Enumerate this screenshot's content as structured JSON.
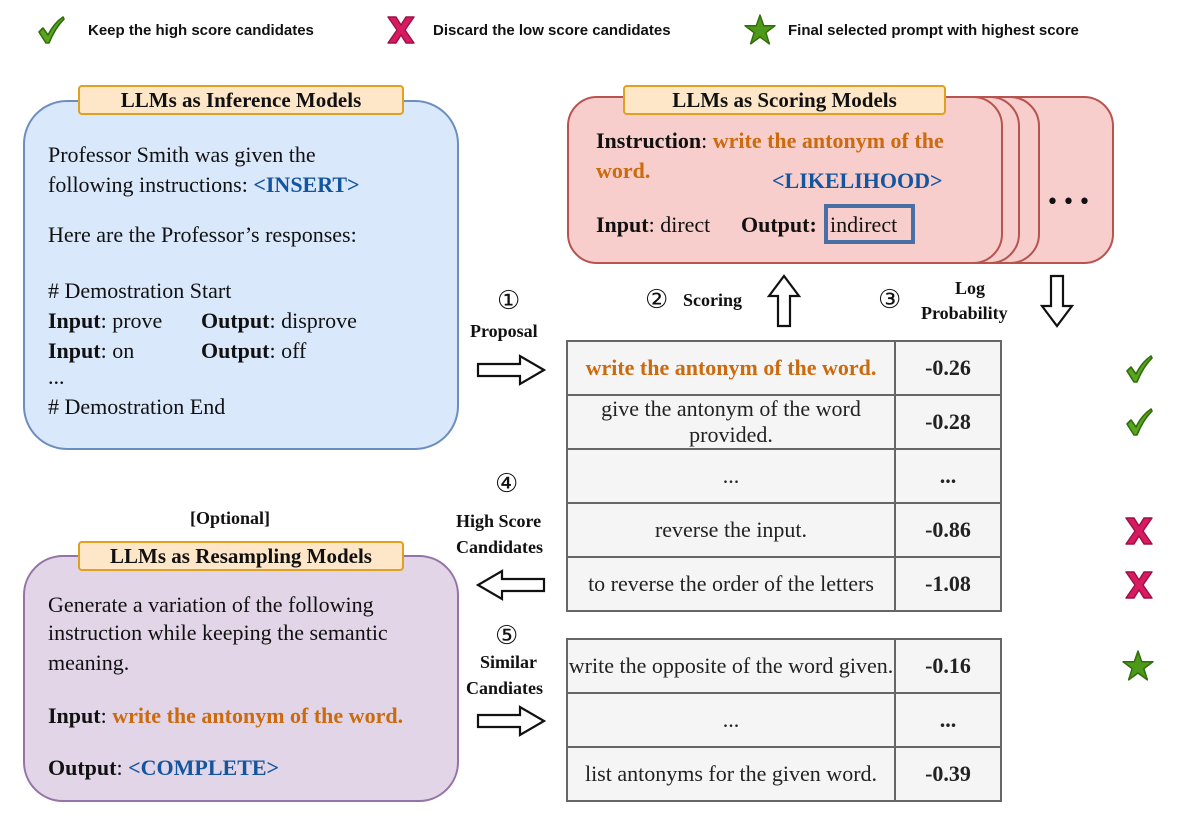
{
  "legend": [
    {
      "icon": "check-icon",
      "label": "Keep the high score candidates"
    },
    {
      "icon": "x-icon",
      "label": "Discard the low score candidates"
    },
    {
      "icon": "star-icon",
      "label": "Final selected prompt with highest score"
    }
  ],
  "colors": {
    "check_green": "#4d9a1a",
    "x_magenta": "#c2185b",
    "star_green": "#4d9a1a",
    "inference_fill": "#dae8fc",
    "scoring_fill": "#f8cecc",
    "resampling_fill": "#e1d5e7",
    "tag_fill": "#fde7c8",
    "keyword_blue": "#1455a0",
    "keyword_orange": "#cc6a0e",
    "score_good": "#1a9a1a",
    "score_bad": "#990000"
  },
  "inference": {
    "title": "LLMs as Inference Models",
    "line1": "Professor Smith was given the",
    "line2_prefix": "following instructions: ",
    "line2_keyword": "<INSERT>",
    "line3": "Here are the Professor’s responses:",
    "demo_start": "# Demostration Start",
    "examples": [
      {
        "input_label": "Input",
        "input": ": prove",
        "output_label": "Output",
        "output": ": disprove"
      },
      {
        "input_label": "Input",
        "input": ": on",
        "output_label": "Output",
        "output": ": off"
      }
    ],
    "ellipsis": "...",
    "demo_end": "# Demostration End"
  },
  "scoring": {
    "title": "LLMs as Scoring Models",
    "instruction_label": "Instruction",
    "instruction_sep": ": ",
    "instruction_line1": "write the antonym of the",
    "instruction_line2": "word.",
    "likelihood": "<LIKELIHOOD>",
    "input_label": "Input",
    "input_value": ": direct",
    "output_label": "Output",
    "output_sep": ":",
    "output_value": "indirect",
    "more": "•••"
  },
  "steps": {
    "s1_num": "①",
    "s1_label": "Proposal",
    "s2_num": "②",
    "s2_label": "Scoring",
    "s3_num": "③",
    "s3_label_1": "Log",
    "s3_label_2": "Probability",
    "s4_num": "④",
    "s4_label_1": "High Score",
    "s4_label_2": "Candidates",
    "s5_num": "⑤",
    "s5_label_1": "Similar",
    "s5_label_2": "Candiates"
  },
  "table1": {
    "rows": [
      {
        "text": "write the antonym of the word.",
        "score": "-0.26",
        "status": "keep",
        "highlight": true
      },
      {
        "text": "give the antonym of the word provided.",
        "score": "-0.28",
        "status": "keep"
      },
      {
        "text": "...",
        "score": "...",
        "status": "none"
      },
      {
        "text": "reverse the input.",
        "score": "-0.86",
        "status": "discard"
      },
      {
        "text": "to reverse the order of the letters",
        "score": "-1.08",
        "status": "discard"
      }
    ]
  },
  "table2": {
    "rows": [
      {
        "text": "write the opposite of the word given.",
        "score": "-0.16",
        "status": "final"
      },
      {
        "text": "...",
        "score": "...",
        "status": "none"
      },
      {
        "text": "list antonyms for the given word.",
        "score": "-0.39",
        "status": "none"
      }
    ]
  },
  "resampling": {
    "optional": "[Optional]",
    "title": "LLMs as Resampling Models",
    "line1": "Generate a variation of the following",
    "line2": "instruction while keeping the semantic",
    "line3": "meaning.",
    "input_label": "Input",
    "input_sep": ": ",
    "input_value": "write the antonym of the word.",
    "output_label": "Output",
    "output_sep": ": ",
    "output_value": "<COMPLETE>"
  }
}
